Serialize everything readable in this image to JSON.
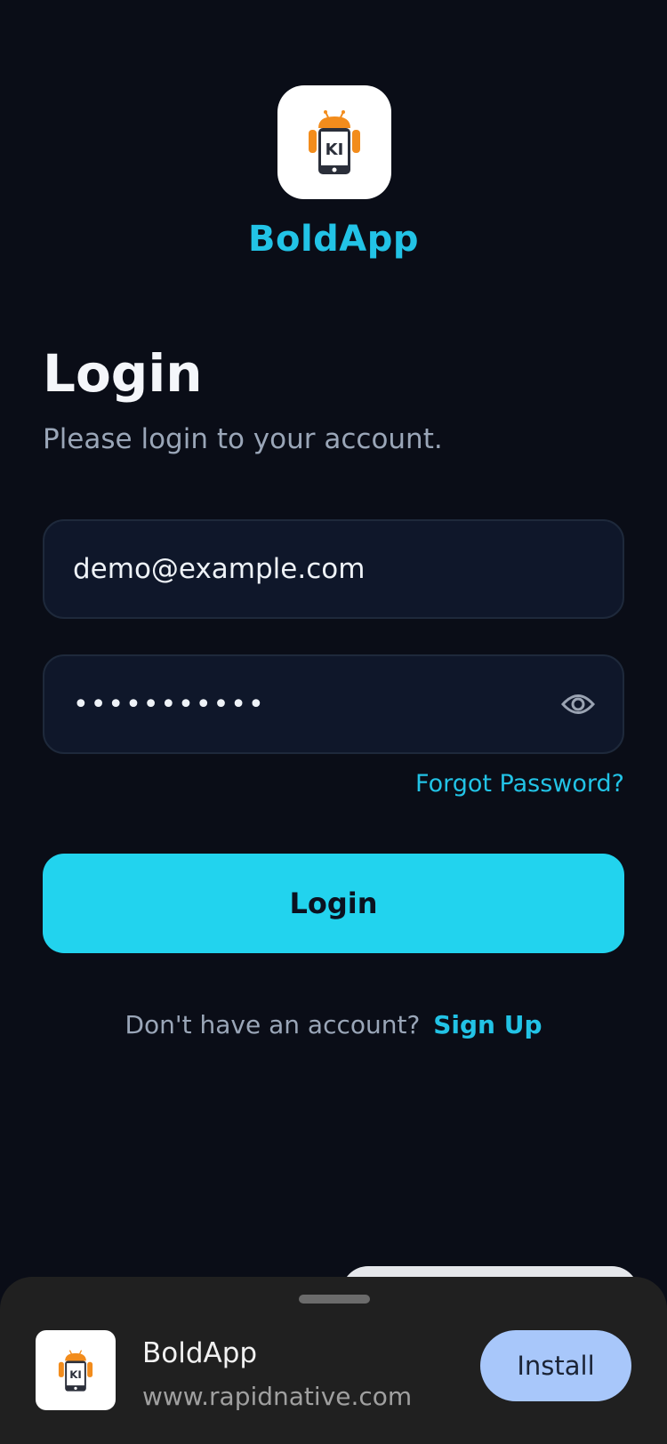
{
  "app": {
    "name": "BoldApp",
    "logo_icon": "robot-phone-logo-icon",
    "logo_text": "KI"
  },
  "login": {
    "title": "Login",
    "subtitle": "Please login to your account.",
    "email_value": "demo@example.com",
    "password_masked": "•••••••••••",
    "eye_icon": "eye-icon",
    "forgot_label": "Forgot Password?",
    "button_label": "Login",
    "signup_prompt": "Don't have an account?",
    "signup_link": "Sign Up"
  },
  "install_sheet": {
    "app_name": "BoldApp",
    "url": "www.rapidnative.com",
    "install_label": "Install"
  },
  "colors": {
    "background": "#0a0d17",
    "accent": "#22d3ee",
    "link": "#22c3e6",
    "input_bg": "#0f172a",
    "install_button": "#a8c7fa",
    "sheet_bg": "#202020"
  }
}
